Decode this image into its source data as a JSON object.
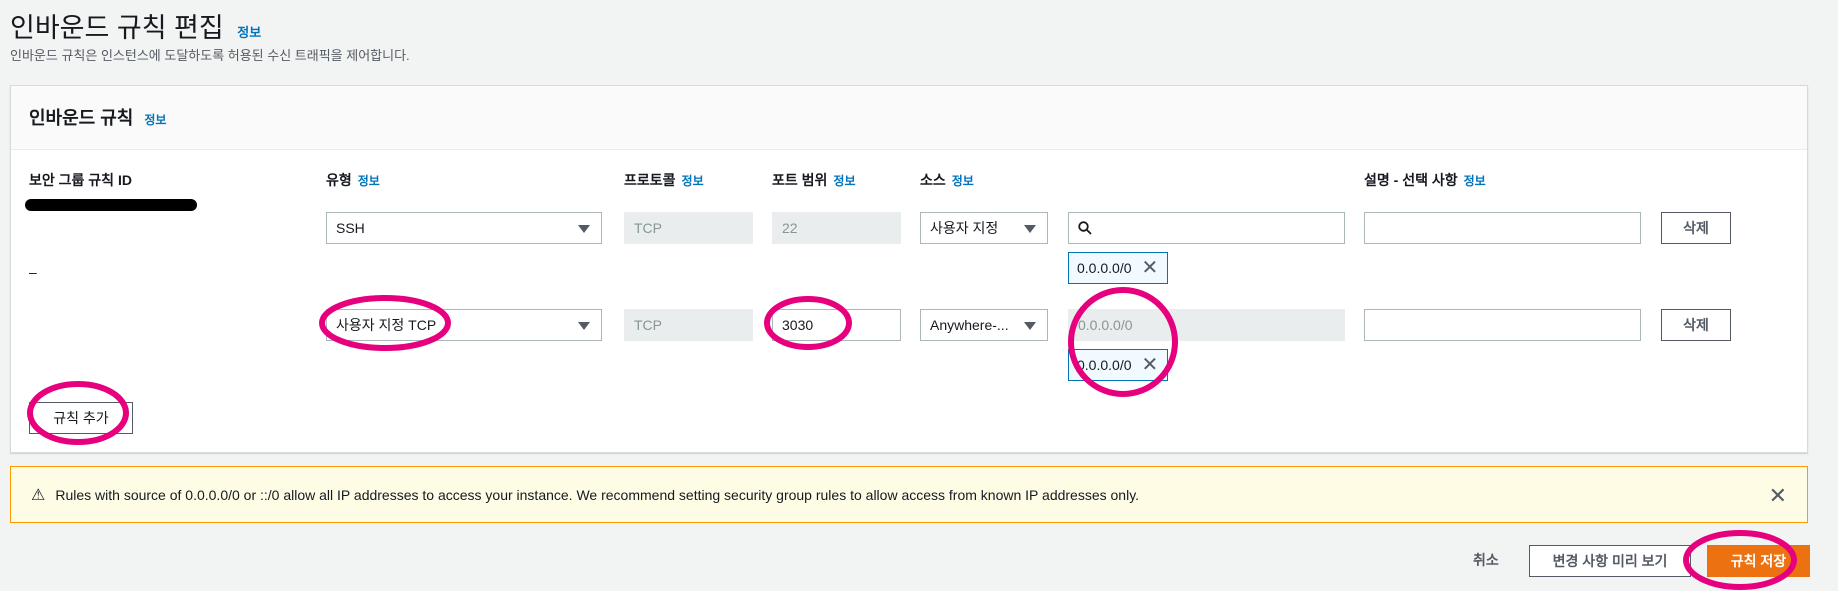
{
  "page": {
    "title": "인바운드 규칙 편집",
    "title_info": "정보",
    "description": "인바운드 규칙은 인스턴스에 도달하도록 허용된 수신 트래픽을 제어합니다."
  },
  "panel": {
    "title": "인바운드 규칙",
    "title_info": "정보",
    "columns": {
      "rule_id": "보안 그룹 규칙 ID",
      "type": "유형",
      "protocol": "프로토콜",
      "port_range": "포트 범위",
      "source": "소스",
      "description": "설명 - 선택 사항",
      "info": "정보"
    },
    "rows": [
      {
        "rule_id": "",
        "type": "SSH",
        "protocol": "TCP",
        "port_range": "22",
        "source": "사용자 지정",
        "source_search": "",
        "cidr": "0.0.0.0/0",
        "description": "",
        "delete": "삭제"
      },
      {
        "rule_id": "–",
        "type": "사용자 지정 TCP",
        "protocol": "TCP",
        "port_range": "3030",
        "source": "Anywhere-...",
        "source_search": "0.0.0.0/0",
        "cidr": "0.0.0.0/0",
        "description": "",
        "delete": "삭제"
      }
    ],
    "add_rule": "규칙 추가"
  },
  "alert": {
    "text": "Rules with source of 0.0.0.0/0 or ::/0 allow all IP addresses to access your instance. We recommend setting security group rules to allow access from known IP addresses only."
  },
  "footer": {
    "cancel": "취소",
    "preview": "변경 사항 미리 보기",
    "save": "규칙 저장"
  },
  "colors": {
    "link": "#0073bb",
    "primary": "#ec7211",
    "warning_border": "#ff9900",
    "annotation": "#e6007e"
  },
  "icons": [
    "search-icon",
    "chevron-down-icon",
    "close-icon",
    "warning-icon"
  ]
}
